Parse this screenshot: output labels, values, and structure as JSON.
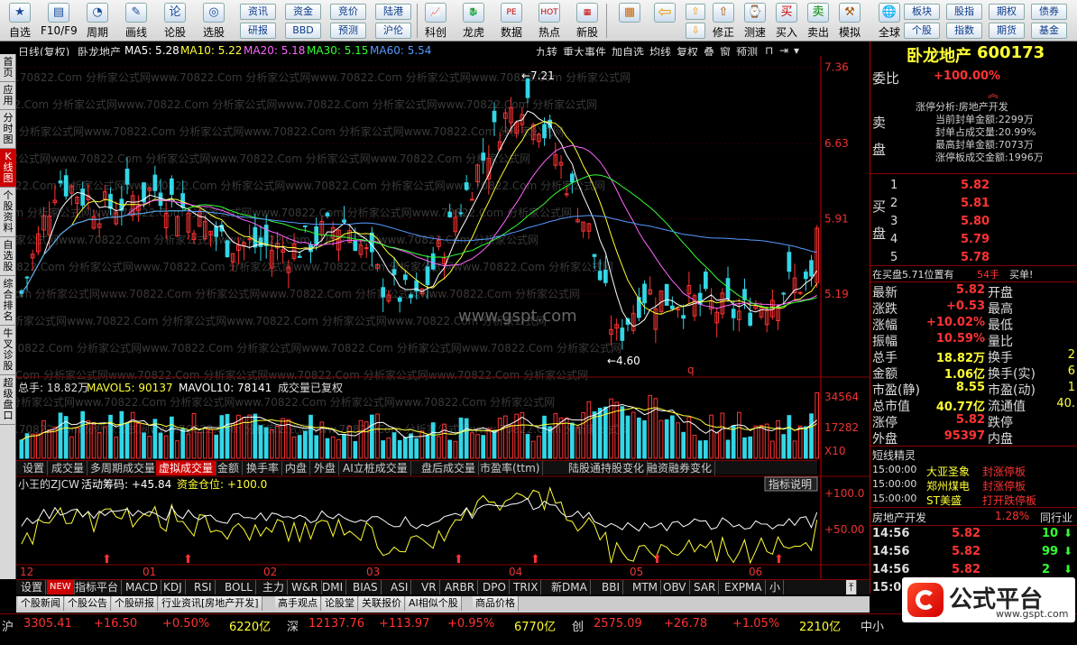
{
  "toolbar": {
    "big": [
      {
        "label": "自选",
        "icon": "★"
      },
      {
        "label": "F10/F9",
        "icon": "▤"
      },
      {
        "label": "周期",
        "icon": "◔"
      },
      {
        "label": "画线",
        "icon": "✎"
      },
      {
        "label": "论股",
        "icon": "论"
      },
      {
        "label": "选股",
        "icon": "◎"
      }
    ],
    "small_top": [
      "资讯",
      "资金",
      "竞价",
      "陆港"
    ],
    "small_bottom": [
      "研报",
      "BBD",
      "预测",
      "沪伦"
    ],
    "big2": [
      {
        "label": "科创",
        "icon": "📈"
      },
      {
        "label": "龙虎",
        "icon": "🐉"
      },
      {
        "label": "数据",
        "icon": "PE"
      },
      {
        "label": "热点",
        "icon": "HOT"
      },
      {
        "label": "新股",
        "icon": "▦"
      }
    ],
    "big3": [
      {
        "label": "",
        "icon": "▦"
      },
      {
        "label": "",
        "icon": "⇦"
      },
      {
        "label": "",
        "icon": "⇧"
      },
      {
        "label": "",
        "icon": "⇧"
      },
      {
        "label": "",
        "icon": "⇧"
      }
    ],
    "small2_top": [
      "⇧",
      "⇧"
    ],
    "small2_bottom": [
      "⇩",
      "⇩"
    ],
    "big4": [
      {
        "label": "修正",
        "icon": "⇧"
      },
      {
        "label": "测速",
        "icon": "⌚"
      },
      {
        "label": "买入",
        "icon": "买"
      },
      {
        "label": "卖出",
        "icon": "卖"
      },
      {
        "label": "模拟",
        "icon": "⚒"
      },
      {
        "label": "全球",
        "icon": "🌐"
      }
    ],
    "small3_top": [
      "板块",
      "股指",
      "期权",
      "债券"
    ],
    "small3_bottom": [
      "个股",
      "指数",
      "期货",
      "基金"
    ]
  },
  "left_tabs": [
    "首页",
    "应用",
    "分时图",
    "K线图",
    "个股资料",
    "自选股",
    "综合排名",
    "牛叉诊股",
    "超级盘口"
  ],
  "header": {
    "period": "日线(复权)",
    "name": "卧龙地产",
    "ma5": "MA5: 5.28",
    "ma10": "MA10: 5.22",
    "ma20": "MA20: 5.18",
    "ma30": "MA30: 5.15",
    "ma60": "MA60: 5.54",
    "right_buttons": [
      "九转",
      "重大事件",
      "加自选",
      "均线",
      "复权",
      "叠",
      "窗",
      "预测"
    ]
  },
  "price_axis": [
    "7.36",
    "6.63",
    "5.91",
    "5.19"
  ],
  "high_label": "7.21",
  "low_label": "4.60",
  "q_label": "q",
  "watermark": "www.gspt.com",
  "watermark_row": ".70822.Com 分析家公式网www.70822.Com 分析家公式网www.70822.Com 分析家公式网www.70822.Com 分析家公式网",
  "volume": {
    "label": "总手: 18.82万",
    "mavol5": "MAVOL5: 90137",
    "mavol10": "MAVOL10: 78141",
    "note": "成交量已复权",
    "axis": [
      "34564",
      "17282",
      "X10"
    ]
  },
  "bottom_tabs": [
    "设置",
    "成交量",
    "多周期成交量",
    "虚拟成交量",
    "金额",
    "换手率",
    "内盘",
    "外盘",
    "AI立桩成交量",
    "盘后成交量",
    "市盈率(ttm)",
    "陆股通持股变化",
    "融资融券变化"
  ],
  "indicator": {
    "title": "小王的ZJCW",
    "label1": "活动筹码: +45.84",
    "label2": "资金仓位: +100.0",
    "button": "指标说明",
    "axis": [
      "+100.0",
      "+50.00"
    ]
  },
  "months": [
    "12",
    "01",
    "02",
    "03",
    "04",
    "05",
    "06"
  ],
  "indicator_tabs": [
    "设置",
    "NEW",
    "指标平台",
    "MACD",
    "KDJ",
    "RSI",
    "BOLL",
    "主力",
    "W&R",
    "DMI",
    "BIAS",
    "ASI",
    "VR",
    "ARBR",
    "DPO",
    "TRIX",
    "新DMA",
    "BBI",
    "MTM",
    "OBV",
    "SAR",
    "EXPMA",
    "小"
  ],
  "news_tabs": [
    "个股新闻",
    "个股公告",
    "个股研报",
    "行业资讯[房地产开发]",
    "高手观点",
    "论股堂",
    "关联报价",
    "AI相似个股",
    "商品价格"
  ],
  "right": {
    "stock_name": "卧龙地产",
    "stock_code": "600173",
    "weibi_label": "委比",
    "weibi_value": "+100.00%",
    "sell_label": "卖盘",
    "buy_label": "买盘",
    "zt_title": "涨停分析:",
    "zt_sector": "房地产开发",
    "zt_lines": [
      "当前封单金额:2299万",
      "封单占成交量:20.99%",
      "最高封单金额:7073万",
      "涨停板成交金额:1996万"
    ],
    "bids": [
      [
        "1",
        "5.82"
      ],
      [
        "2",
        "5.81"
      ],
      [
        "3",
        "5.80"
      ],
      [
        "4",
        "5.79"
      ],
      [
        "5",
        "5.78"
      ]
    ],
    "inbuy": "在买盘5.71位置有",
    "inbuy_vol": "54手",
    "inbuy_btn": "买单!",
    "stats": [
      [
        "最新",
        "5.82",
        "开盘",
        ""
      ],
      [
        "涨跌",
        "+0.53",
        "最高",
        ""
      ],
      [
        "涨幅",
        "+10.02%",
        "最低",
        ""
      ],
      [
        "振幅",
        "10.59%",
        "量比",
        ""
      ],
      [
        "总手",
        "18.82万",
        "换手",
        "2"
      ],
      [
        "金额",
        "1.06亿",
        "换手(实)",
        "6"
      ],
      [
        "市盈(静)",
        "8.55",
        "市盈(动)",
        "1"
      ],
      [
        "总市值",
        "40.77亿",
        "流通值",
        "40."
      ],
      [
        "涨停",
        "5.82",
        "跌停",
        ""
      ],
      [
        "外盘",
        "95397",
        "内盘",
        ""
      ]
    ],
    "short_title": "短线精灵",
    "short_lines": [
      [
        "15:00:00",
        "大亚圣象",
        "封涨停板"
      ],
      [
        "15:00:00",
        "郑州煤电",
        "封涨停板"
      ],
      [
        "15:00:00",
        "ST美盛",
        "打开跌停板"
      ]
    ],
    "sector_name": "房地产开发",
    "sector_pct": "1.28%",
    "sector_more": "同行业",
    "ticks": [
      [
        "14:56",
        "5.82",
        "10"
      ],
      [
        "14:56",
        "5.82",
        "99"
      ],
      [
        "14:56",
        "5.82",
        "2"
      ],
      [
        "15:00",
        "",
        ""
      ]
    ]
  },
  "ticker": [
    {
      "name": "沪",
      "value": "3305.41",
      "chg": "+16.50",
      "pct": "+0.50%",
      "amt": "6220亿"
    },
    {
      "name": "深",
      "value": "12137.76",
      "chg": "+113.97",
      "pct": "+0.95%",
      "amt": "6770亿"
    },
    {
      "name": "创",
      "value": "2575.09",
      "chg": "+26.78",
      "pct": "+1.05%",
      "amt": "2210亿"
    }
  ],
  "ticker_tail": "中小",
  "logo": {
    "text": "公式平台",
    "url": "www.gspt.com"
  },
  "colors": {
    "up": "#ff3333",
    "down": "#33d6e6",
    "ma5": "#ffffff",
    "ma10": "#ffff33",
    "ma20": "#ff66ff",
    "ma30": "#33ff33",
    "ma60": "#5599ff"
  }
}
